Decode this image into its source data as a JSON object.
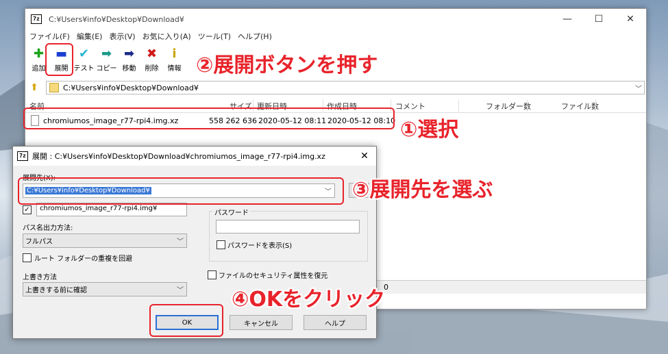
{
  "main_window": {
    "icon_text": "7z",
    "title": "C:¥Users¥info¥Desktop¥Download¥",
    "controls": {
      "minimize": "—",
      "maximize": "☐",
      "close": "✕"
    },
    "menu": [
      "ファイル(F)",
      "編集(E)",
      "表示(V)",
      "お気に入り(A)",
      "ツール(T)",
      "ヘルプ(H)"
    ],
    "toolbar": [
      {
        "label": "追加",
        "icon": "plus-icon",
        "glyph": "✚",
        "color": "#1aa31a"
      },
      {
        "label": "展開",
        "icon": "minus-icon",
        "glyph": "▬",
        "color": "#1a3fd0"
      },
      {
        "label": "テスト",
        "icon": "check-icon",
        "glyph": "✔",
        "color": "#28b4d4"
      },
      {
        "label": "コピー",
        "icon": "copy-arrow-icon",
        "glyph": "➡",
        "color": "#1a9a8a"
      },
      {
        "label": "移動",
        "icon": "move-arrow-icon",
        "glyph": "➡",
        "color": "#1a2a8a"
      },
      {
        "label": "削除",
        "icon": "delete-x-icon",
        "glyph": "✖",
        "color": "#d01a1a"
      },
      {
        "label": "情報",
        "icon": "info-icon",
        "glyph": "i",
        "color": "#c9a400"
      }
    ],
    "address": "C:¥Users¥info¥Desktop¥Download¥",
    "columns": [
      "名前",
      "サイズ",
      "更新日時",
      "作成日時",
      "コメント",
      "フォルダー数",
      "ファイル数"
    ],
    "files": [
      {
        "name": "chromiumos_image_r77-rpi4.img.xz",
        "size": "558 262 636",
        "modified": "2020-05-12 08:11",
        "created": "2020-05-12 08:10"
      }
    ],
    "status_text": "0"
  },
  "dialog": {
    "icon_text": "7z",
    "title": "展開 : C:¥Users¥info¥Desktop¥Download¥chromiumos_image_r77-rpi4.img.xz",
    "close": "✕",
    "dest_label": "展開先(X):",
    "dest_value": "C:¥Users¥info¥Desktop¥Download¥",
    "subfolder_value": "chromiumos_image_r77-rpi4.img¥",
    "path_mode_label": "パス名出力方法:",
    "path_mode_value": "フルパス",
    "root_dup_label": "ルート フォルダーの重複を回避",
    "overwrite_label": "上書き方法",
    "overwrite_value": "上書きする前に確認",
    "password_label": "パスワード",
    "show_password_label": "パスワードを表示(S)",
    "security_label": "ファイルのセキュリティ属性を復元",
    "buttons": {
      "ok": "OK",
      "cancel": "キャンセル",
      "help": "ヘルプ"
    }
  },
  "annotations": {
    "step1": "①選択",
    "step2": "②展開ボタンを押す",
    "step3": "③展開先を選ぶ",
    "step4": "④OKをクリック",
    "color": "#e8232b"
  }
}
